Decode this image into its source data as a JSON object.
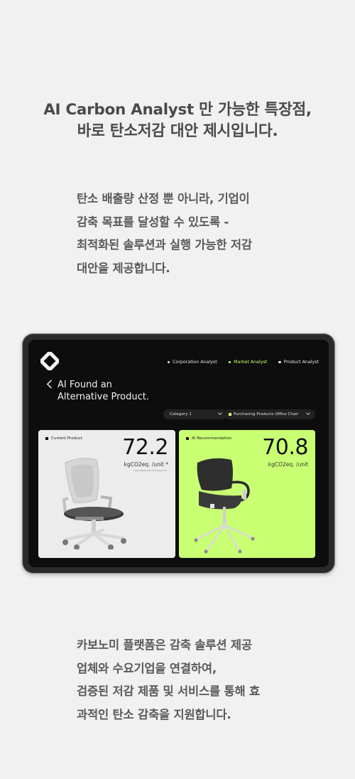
{
  "headline": {
    "line1": "AI Carbon Analyst 만 가능한 특장점,",
    "line2": "바로 탄소저감 대안 제시입니다."
  },
  "intro": {
    "lines": [
      "탄소 배출량 산정 뿐 아니라, 기업이",
      "감축 목표를 달성할 수 있도록 -",
      "최적화된 솔루션과 실행 가능한 저감",
      "대안을 제공합니다."
    ]
  },
  "app": {
    "logo_icon": "brand-logo-icon",
    "nav": [
      {
        "label": "Corporation Analyst",
        "active": false
      },
      {
        "label": "Market Analyst",
        "active": true
      },
      {
        "label": "Product Analyst",
        "active": false
      }
    ],
    "title_line1": "AI Found an",
    "title_line2": "Alternative Product.",
    "back_icon": "chevron-left-icon",
    "selects": {
      "category": "Category 1",
      "purchasing": "Purchasing Products Office Chair"
    },
    "cards": {
      "current": {
        "label": "Current Product",
        "value": "72.2",
        "unit": "kgCO2eq. /unit *",
        "note": "* Calculated with Ecoinvent 3.8"
      },
      "recommendation": {
        "label": "AI Recommendation",
        "value": "70.8",
        "unit": "kgCO2eq. /unit"
      }
    },
    "accent_color": "#c9ff72"
  },
  "outro": {
    "lines": [
      "카보노미 플랫폼은 감축 솔루션 제공",
      "업체와 수요기업을 연결하여,",
      "검증된 저감 제품 및 서비스를 통해 효",
      "과적인 탄소 감축을 지원합니다."
    ]
  }
}
